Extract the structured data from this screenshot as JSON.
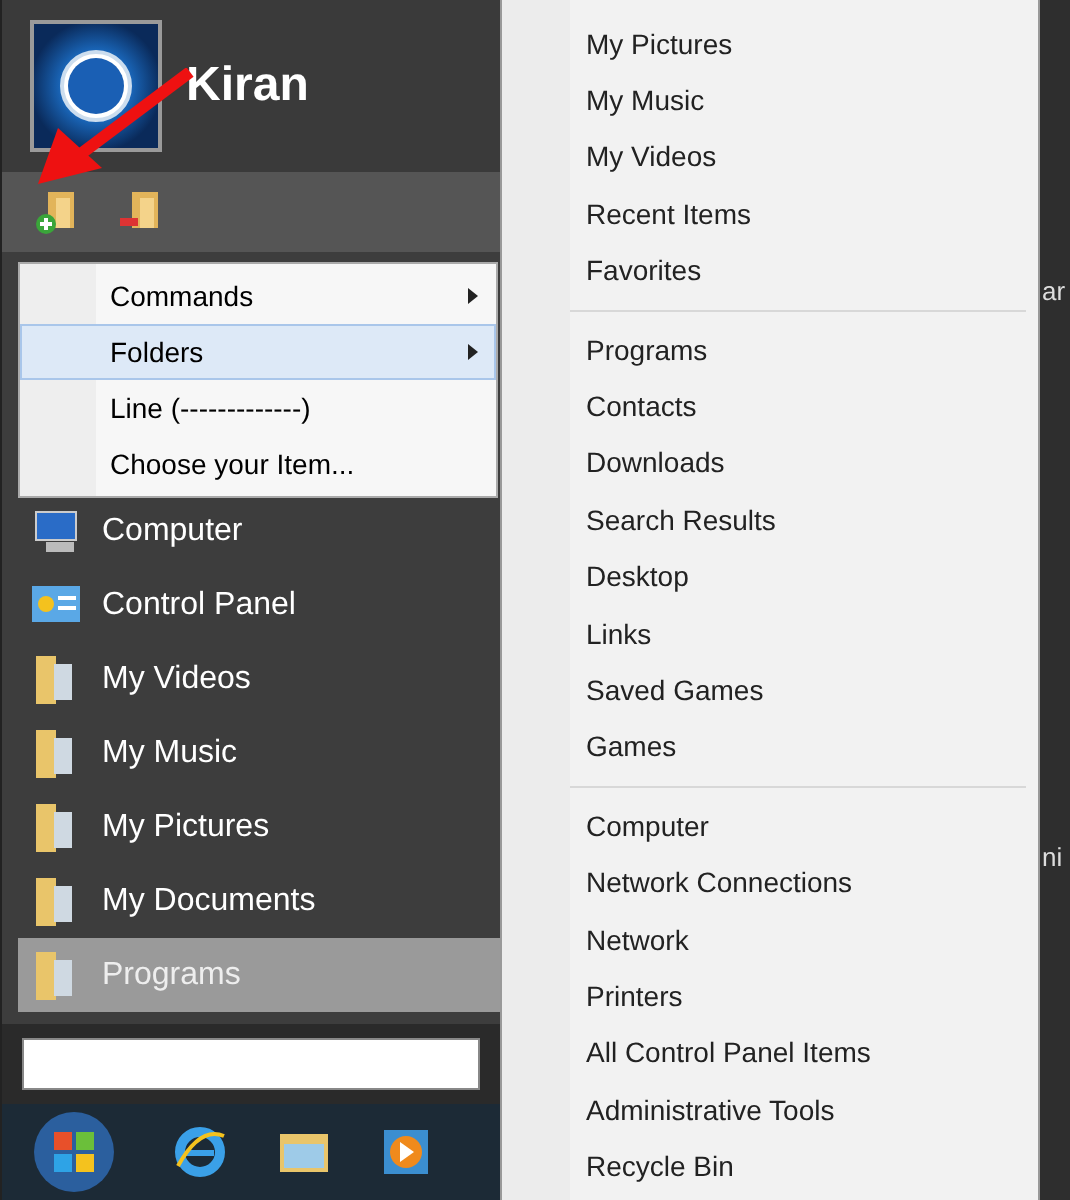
{
  "user": {
    "name": "Kiran"
  },
  "context_menu": [
    {
      "label": "Commands",
      "submenu": true,
      "selected": false
    },
    {
      "label": "Folders",
      "submenu": true,
      "selected": true
    },
    {
      "label": "Line (-------------)",
      "submenu": false,
      "selected": false
    },
    {
      "label": "Choose your Item...",
      "submenu": false,
      "selected": false
    }
  ],
  "start_items": [
    {
      "label": "Computer",
      "kind": "computer",
      "selected": false
    },
    {
      "label": "Control Panel",
      "kind": "control",
      "selected": false
    },
    {
      "label": "My Videos",
      "kind": "folder",
      "selected": false
    },
    {
      "label": "My Music",
      "kind": "folder",
      "selected": false
    },
    {
      "label": "My Pictures",
      "kind": "folder",
      "selected": false
    },
    {
      "label": "My Documents",
      "kind": "folder",
      "selected": false
    },
    {
      "label": "Programs",
      "kind": "folder",
      "selected": true
    }
  ],
  "folders_menu": [
    [
      "My Pictures",
      "My Music",
      "My Videos",
      "Recent Items",
      "Favorites"
    ],
    [
      "Programs",
      "Contacts",
      "Downloads",
      "Search Results",
      "Desktop",
      "Links",
      "Saved Games",
      "Games"
    ],
    [
      "Computer",
      "Network Connections",
      "Network",
      "Printers",
      "All Control Panel Items",
      "Administrative Tools",
      "Recycle Bin"
    ]
  ],
  "background_fragments": [
    "ar",
    "ni"
  ]
}
